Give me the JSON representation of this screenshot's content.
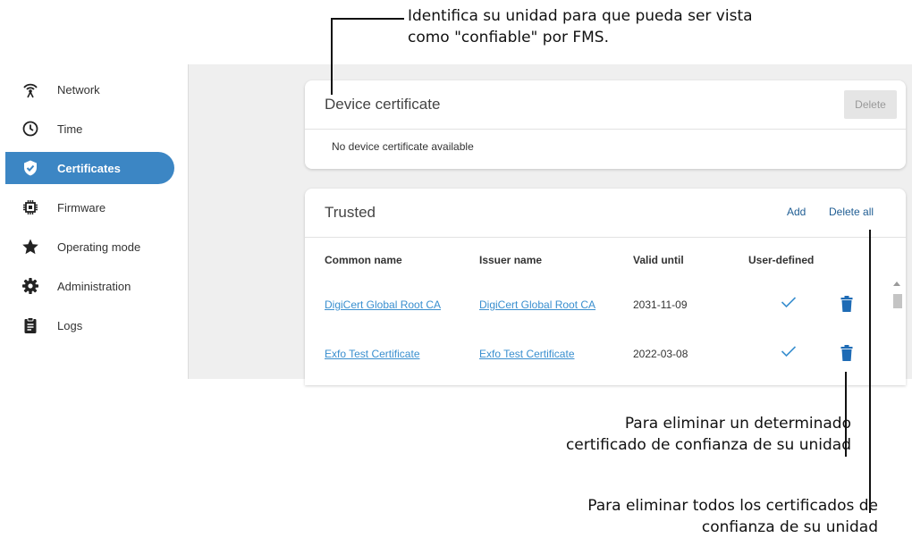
{
  "callouts": {
    "top_line1": "Identifica su unidad para que pueda ser vista",
    "top_line2": "como \"confiable\" por FMS.",
    "middle_line1": "Para eliminar un determinado",
    "middle_line2": "certificado de confianza de su unidad",
    "bottom_line1": "Para eliminar todos los certificados de",
    "bottom_line2": "confianza de su unidad"
  },
  "sidebar": {
    "items": [
      {
        "label": "Network",
        "icon": "network-icon",
        "active": false
      },
      {
        "label": "Time",
        "icon": "clock-icon",
        "active": false
      },
      {
        "label": "Certificates",
        "icon": "shield-check-icon",
        "active": true
      },
      {
        "label": "Firmware",
        "icon": "chip-icon",
        "active": false
      },
      {
        "label": "Operating mode",
        "icon": "star-icon",
        "active": false
      },
      {
        "label": "Administration",
        "icon": "gear-icon",
        "active": false
      },
      {
        "label": "Logs",
        "icon": "clipboard-icon",
        "active": false
      }
    ]
  },
  "device_certificate": {
    "title": "Device certificate",
    "delete_label": "Delete",
    "empty_message": "No device certificate available"
  },
  "trusted": {
    "title": "Trusted",
    "add_label": "Add",
    "delete_all_label": "Delete all",
    "columns": [
      "Common name",
      "Issuer name",
      "Valid until",
      "User-defined"
    ],
    "rows": [
      {
        "common_name": "DigiCert Global Root CA",
        "issuer_name": "DigiCert Global Root CA",
        "valid_until": "2031-11-09",
        "user_defined": true
      },
      {
        "common_name": "Exfo Test Certificate",
        "issuer_name": "Exfo Test Certificate",
        "valid_until": "2022-03-08",
        "user_defined": true
      }
    ]
  },
  "colors": {
    "accent": "#3c86c4",
    "link": "#3a8fcf",
    "trash": "#1e6bb5"
  }
}
